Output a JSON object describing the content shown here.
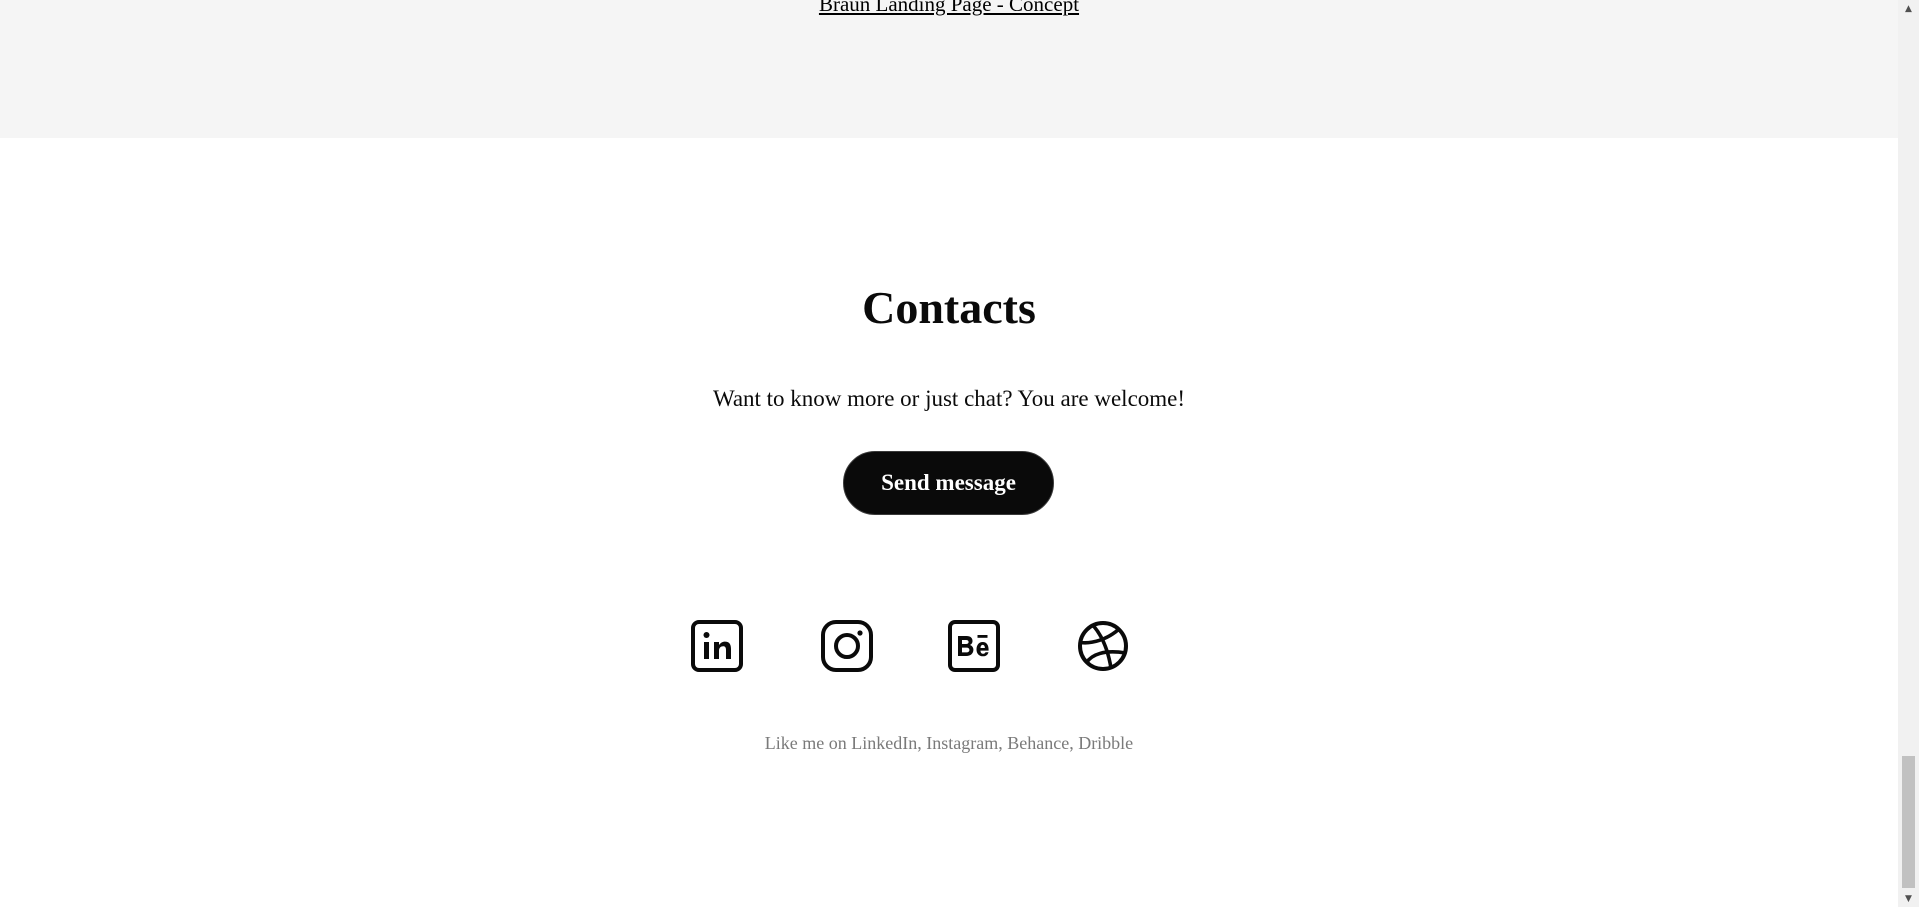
{
  "projects": {
    "last_link": "Braun Landing Page - Concept"
  },
  "contacts": {
    "title": "Contacts",
    "subtitle": "Want to know more or just chat? You are welcome!",
    "send_button_label": "Send message",
    "social": [
      {
        "name": "LinkedIn",
        "icon": "linkedin-icon"
      },
      {
        "name": "Instagram",
        "icon": "instagram-icon"
      },
      {
        "name": "Behance",
        "icon": "behance-icon"
      },
      {
        "name": "Dribble",
        "icon": "dribbble-icon"
      }
    ],
    "footer_note": "Like me on LinkedIn, Instagram, Behance, Dribble"
  },
  "scrollbar": {
    "up_arrow": "▲",
    "down_arrow": "▼"
  },
  "colors": {
    "band_background": "#f5f5f5",
    "button_background": "#0a0a0a",
    "footer_text": "#7a7a7a"
  }
}
